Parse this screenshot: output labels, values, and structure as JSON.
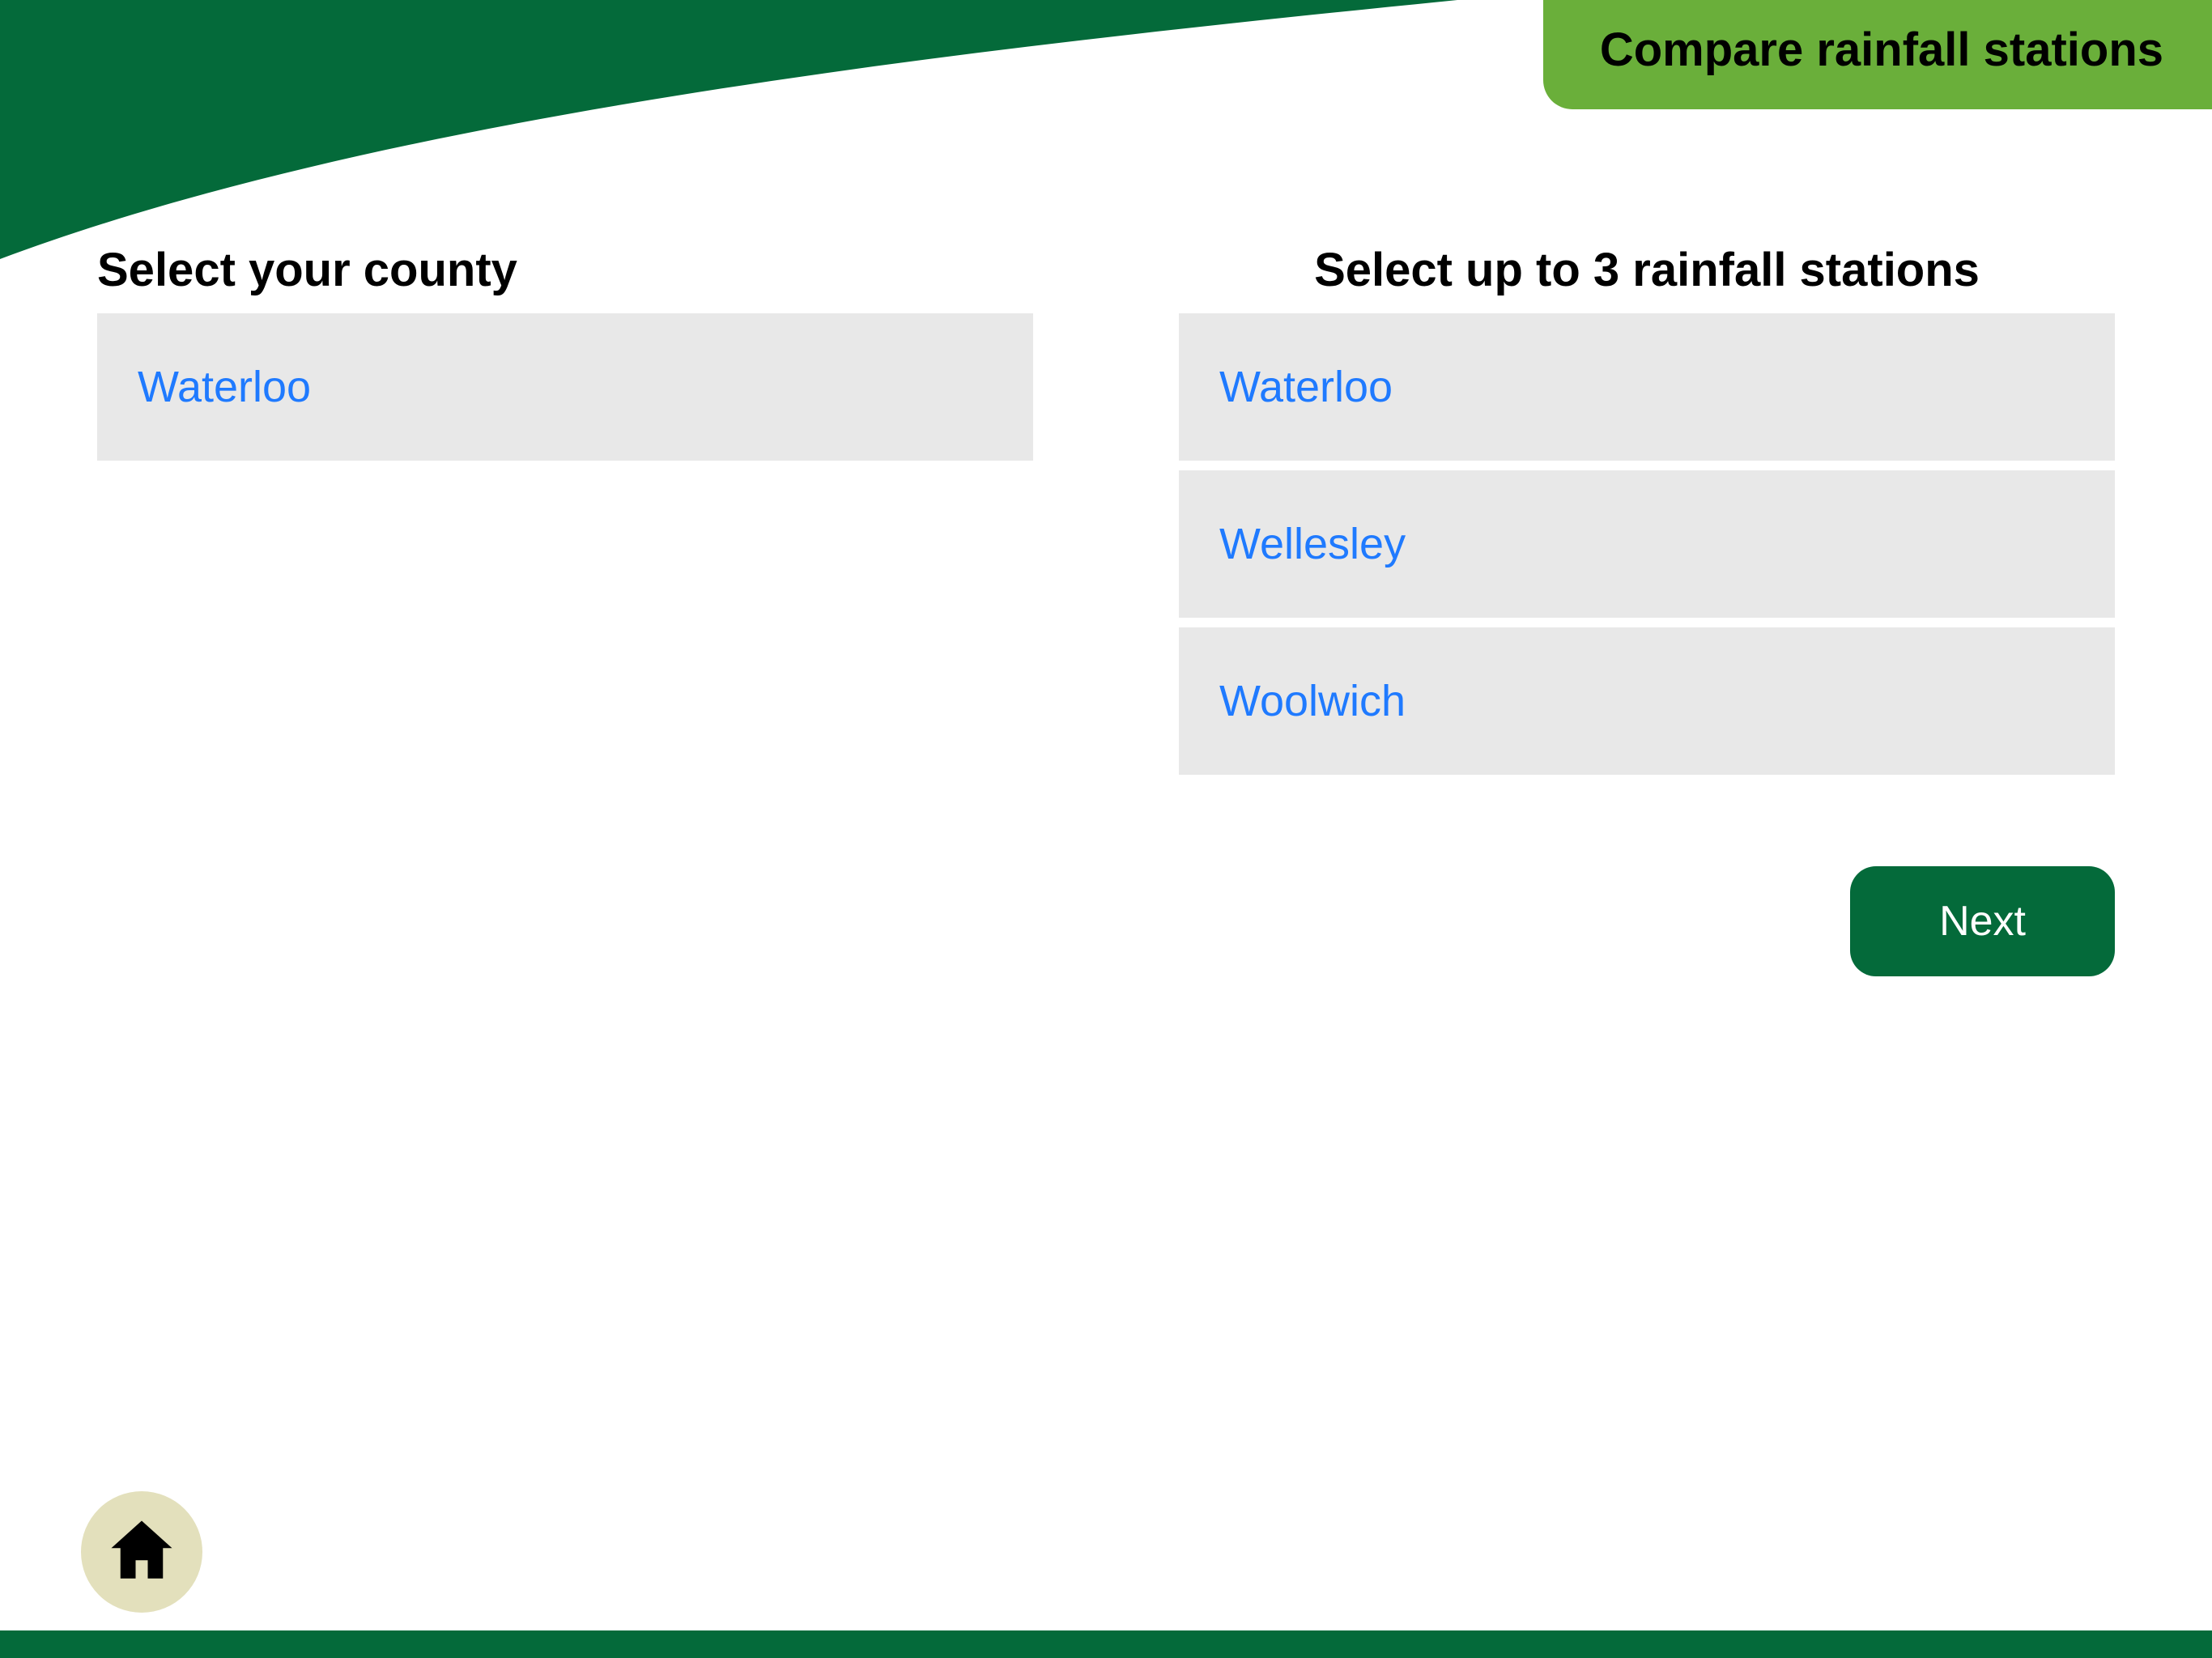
{
  "title": "Compare rainfall stations",
  "county": {
    "heading": "Select your county",
    "items": [
      "Waterloo"
    ]
  },
  "stations": {
    "heading": "Select up to 3 rainfall stations",
    "items": [
      "Waterloo",
      "Wellesley",
      "Woolwich"
    ]
  },
  "buttons": {
    "next": "Next"
  }
}
